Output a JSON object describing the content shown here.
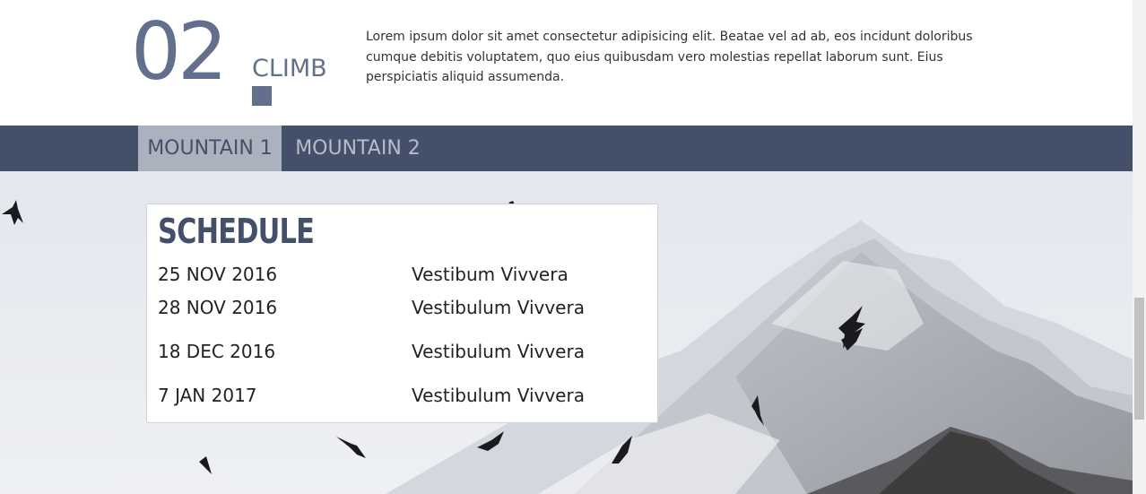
{
  "section": {
    "number": "02",
    "title": "CLIMB",
    "intro": "Lorem ipsum dolor sit amet consectetur adipisicing elit. Beatae vel ad ab, eos incidunt doloribus cumque debitis voluptatem, quo eius quibusdam vero molestias repellat laborum sunt. Eius perspiciatis aliquid assumenda."
  },
  "tabs": [
    {
      "label": "MOUNTAIN 1",
      "active": true
    },
    {
      "label": "MOUNTAIN 2",
      "active": false
    }
  ],
  "schedule": {
    "title": "SCHEDULE",
    "rows": [
      {
        "date": "25 NOV 2016",
        "event": "Vestibum Vivvera"
      },
      {
        "date": "28 NOV 2016",
        "event": "Vestibulum Vivvera"
      },
      {
        "date": "18 DEC 2016",
        "event": "Vestibulum Vivvera"
      },
      {
        "date": "7 JAN 2017",
        "event": "Vestibulum Vivvera"
      }
    ]
  },
  "colors": {
    "accent": "#63708d",
    "tabbar": "#44506a",
    "tab_active_bg": "#acb2bd"
  }
}
